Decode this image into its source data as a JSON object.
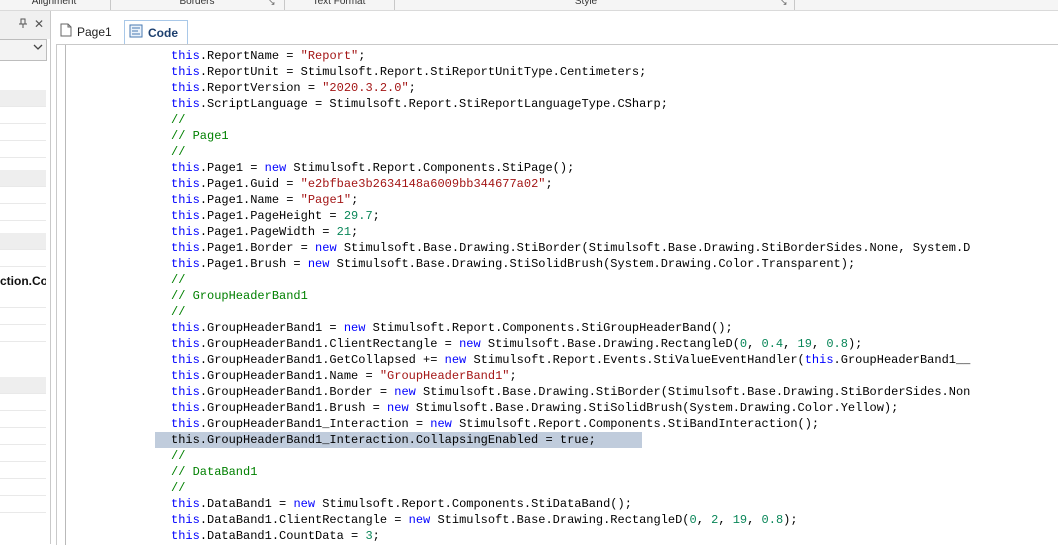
{
  "ribbon": {
    "groups": [
      "Alignment",
      "Borders",
      "Text Format",
      "Style"
    ]
  },
  "left_panel": {
    "visible_text": "ction.Col"
  },
  "tabs": [
    {
      "label": "Page1",
      "active": false
    },
    {
      "label": "Code",
      "active": true
    }
  ],
  "code": {
    "highlighted_line": 24,
    "lines": [
      [
        [
          "kw",
          "this"
        ],
        [
          "",
          "."
        ],
        [
          "",
          "ReportName = "
        ],
        [
          "str",
          "\"Report\""
        ],
        [
          "",
          ";"
        ]
      ],
      [
        [
          "kw",
          "this"
        ],
        [
          "",
          "."
        ],
        [
          "",
          "ReportUnit = Stimulsoft.Report.StiReportUnitType.Centimeters;"
        ]
      ],
      [
        [
          "kw",
          "this"
        ],
        [
          "",
          "."
        ],
        [
          "",
          "ReportVersion = "
        ],
        [
          "str",
          "\"2020.3.2.0\""
        ],
        [
          "",
          ";"
        ]
      ],
      [
        [
          "kw",
          "this"
        ],
        [
          "",
          "."
        ],
        [
          "",
          "ScriptLanguage = Stimulsoft.Report.StiReportLanguageType.CSharp;"
        ]
      ],
      [
        [
          "cmt",
          "//"
        ]
      ],
      [
        [
          "cmt",
          "// Page1"
        ]
      ],
      [
        [
          "cmt",
          "//"
        ]
      ],
      [
        [
          "kw",
          "this"
        ],
        [
          "",
          "."
        ],
        [
          "",
          "Page1 = "
        ],
        [
          "kw",
          "new"
        ],
        [
          "",
          " Stimulsoft.Report.Components.StiPage();"
        ]
      ],
      [
        [
          "kw",
          "this"
        ],
        [
          "",
          "."
        ],
        [
          "",
          "Page1.Guid = "
        ],
        [
          "str",
          "\"e2bfbae3b2634148a6009bb344677a02\""
        ],
        [
          "",
          ";"
        ]
      ],
      [
        [
          "kw",
          "this"
        ],
        [
          "",
          "."
        ],
        [
          "",
          "Page1.Name = "
        ],
        [
          "str",
          "\"Page1\""
        ],
        [
          "",
          ";"
        ]
      ],
      [
        [
          "kw",
          "this"
        ],
        [
          "",
          "."
        ],
        [
          "",
          "Page1.PageHeight = "
        ],
        [
          "num",
          "29.7"
        ],
        [
          "",
          ";"
        ]
      ],
      [
        [
          "kw",
          "this"
        ],
        [
          "",
          "."
        ],
        [
          "",
          "Page1.PageWidth = "
        ],
        [
          "num",
          "21"
        ],
        [
          "",
          ";"
        ]
      ],
      [
        [
          "kw",
          "this"
        ],
        [
          "",
          "."
        ],
        [
          "",
          "Page1.Border = "
        ],
        [
          "kw",
          "new"
        ],
        [
          "",
          " Stimulsoft.Base.Drawing.StiBorder(Stimulsoft.Base.Drawing.StiBorderSides.None, System.D"
        ]
      ],
      [
        [
          "kw",
          "this"
        ],
        [
          "",
          "."
        ],
        [
          "",
          "Page1.Brush = "
        ],
        [
          "kw",
          "new"
        ],
        [
          "",
          " Stimulsoft.Base.Drawing.StiSolidBrush(System.Drawing.Color.Transparent);"
        ]
      ],
      [
        [
          "cmt",
          "//"
        ]
      ],
      [
        [
          "cmt",
          "// GroupHeaderBand1"
        ]
      ],
      [
        [
          "cmt",
          "//"
        ]
      ],
      [
        [
          "kw",
          "this"
        ],
        [
          "",
          "."
        ],
        [
          "",
          "GroupHeaderBand1 = "
        ],
        [
          "kw",
          "new"
        ],
        [
          "",
          " Stimulsoft.Report.Components.StiGroupHeaderBand();"
        ]
      ],
      [
        [
          "kw",
          "this"
        ],
        [
          "",
          "."
        ],
        [
          "",
          "GroupHeaderBand1.ClientRectangle = "
        ],
        [
          "kw",
          "new"
        ],
        [
          "",
          " Stimulsoft.Base.Drawing.RectangleD("
        ],
        [
          "num",
          "0"
        ],
        [
          "",
          ", "
        ],
        [
          "num",
          "0.4"
        ],
        [
          "",
          ", "
        ],
        [
          "num",
          "19"
        ],
        [
          "",
          ", "
        ],
        [
          "num",
          "0.8"
        ],
        [
          "",
          ");"
        ]
      ],
      [
        [
          "kw",
          "this"
        ],
        [
          "",
          "."
        ],
        [
          "",
          "GroupHeaderBand1.GetCollapsed += "
        ],
        [
          "kw",
          "new"
        ],
        [
          "",
          " Stimulsoft.Report.Events.StiValueEventHandler("
        ],
        [
          "kw",
          "this"
        ],
        [
          "",
          ".GroupHeaderBand1__"
        ]
      ],
      [
        [
          "kw",
          "this"
        ],
        [
          "",
          "."
        ],
        [
          "",
          "GroupHeaderBand1.Name = "
        ],
        [
          "str",
          "\"GroupHeaderBand1\""
        ],
        [
          "",
          ";"
        ]
      ],
      [
        [
          "kw",
          "this"
        ],
        [
          "",
          "."
        ],
        [
          "",
          "GroupHeaderBand1.Border = "
        ],
        [
          "kw",
          "new"
        ],
        [
          "",
          " Stimulsoft.Base.Drawing.StiBorder(Stimulsoft.Base.Drawing.StiBorderSides.Non"
        ]
      ],
      [
        [
          "kw",
          "this"
        ],
        [
          "",
          "."
        ],
        [
          "",
          "GroupHeaderBand1.Brush = "
        ],
        [
          "kw",
          "new"
        ],
        [
          "",
          " Stimulsoft.Base.Drawing.StiSolidBrush(System.Drawing.Color.Yellow);"
        ]
      ],
      [
        [
          "kw",
          "this"
        ],
        [
          "",
          "."
        ],
        [
          "",
          "GroupHeaderBand1_Interaction = "
        ],
        [
          "kw",
          "new"
        ],
        [
          "",
          " Stimulsoft.Report.Components.StiBandInteraction();"
        ]
      ],
      [
        [
          "",
          "this.GroupHeaderBand1_Interaction.CollapsingEnabled = true;"
        ]
      ],
      [
        [
          "cmt",
          "//"
        ]
      ],
      [
        [
          "cmt",
          "// DataBand1"
        ]
      ],
      [
        [
          "cmt",
          "//"
        ]
      ],
      [
        [
          "kw",
          "this"
        ],
        [
          "",
          "."
        ],
        [
          "",
          "DataBand1 = "
        ],
        [
          "kw",
          "new"
        ],
        [
          "",
          " Stimulsoft.Report.Components.StiDataBand();"
        ]
      ],
      [
        [
          "kw",
          "this"
        ],
        [
          "",
          "."
        ],
        [
          "",
          "DataBand1.ClientRectangle = "
        ],
        [
          "kw",
          "new"
        ],
        [
          "",
          " Stimulsoft.Base.Drawing.RectangleD("
        ],
        [
          "num",
          "0"
        ],
        [
          "",
          ", "
        ],
        [
          "num",
          "2"
        ],
        [
          "",
          ", "
        ],
        [
          "num",
          "19"
        ],
        [
          "",
          ", "
        ],
        [
          "num",
          "0.8"
        ],
        [
          "",
          ");"
        ]
      ],
      [
        [
          "kw",
          "this"
        ],
        [
          "",
          "."
        ],
        [
          "",
          "DataBand1.CountData = "
        ],
        [
          "num",
          "3"
        ],
        [
          "",
          ";"
        ]
      ]
    ]
  },
  "colors": {
    "keyword": "#0000ff",
    "string": "#a31515",
    "number": "#098658",
    "comment": "#008000",
    "selection": "#c0ccdc",
    "tab_active_border": "#a9c8e8"
  },
  "icons": {
    "pin": "pin-icon",
    "close": "close-icon",
    "combo": "chevron-down-icon",
    "page_tab": "page-icon",
    "code_tab": "code-icon",
    "launcher": "dialog-launcher-icon"
  }
}
